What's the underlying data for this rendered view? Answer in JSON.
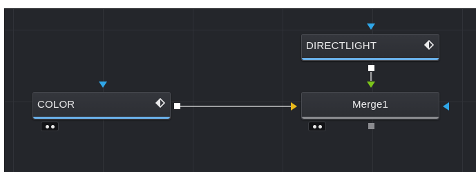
{
  "nodes": {
    "color": {
      "label": "COLOR",
      "accent": "#6ab0e8"
    },
    "directlight": {
      "label": "DIRECTLIGHT",
      "accent": "#6ab0e8"
    },
    "merge": {
      "label": "Merge1",
      "accent": "#8a8b8f"
    }
  },
  "colors": {
    "background_input": "#26a3e8",
    "foreground_input": "#e8b81a",
    "effect_mask_input": "#2fa6e8",
    "light_input": "#7bc41a",
    "connection": "#e8e8e8"
  },
  "icons": {
    "node_view_toggle": "view-toggle-diamond-icon",
    "passthrough_toggle": "dots-toggle-icon"
  }
}
